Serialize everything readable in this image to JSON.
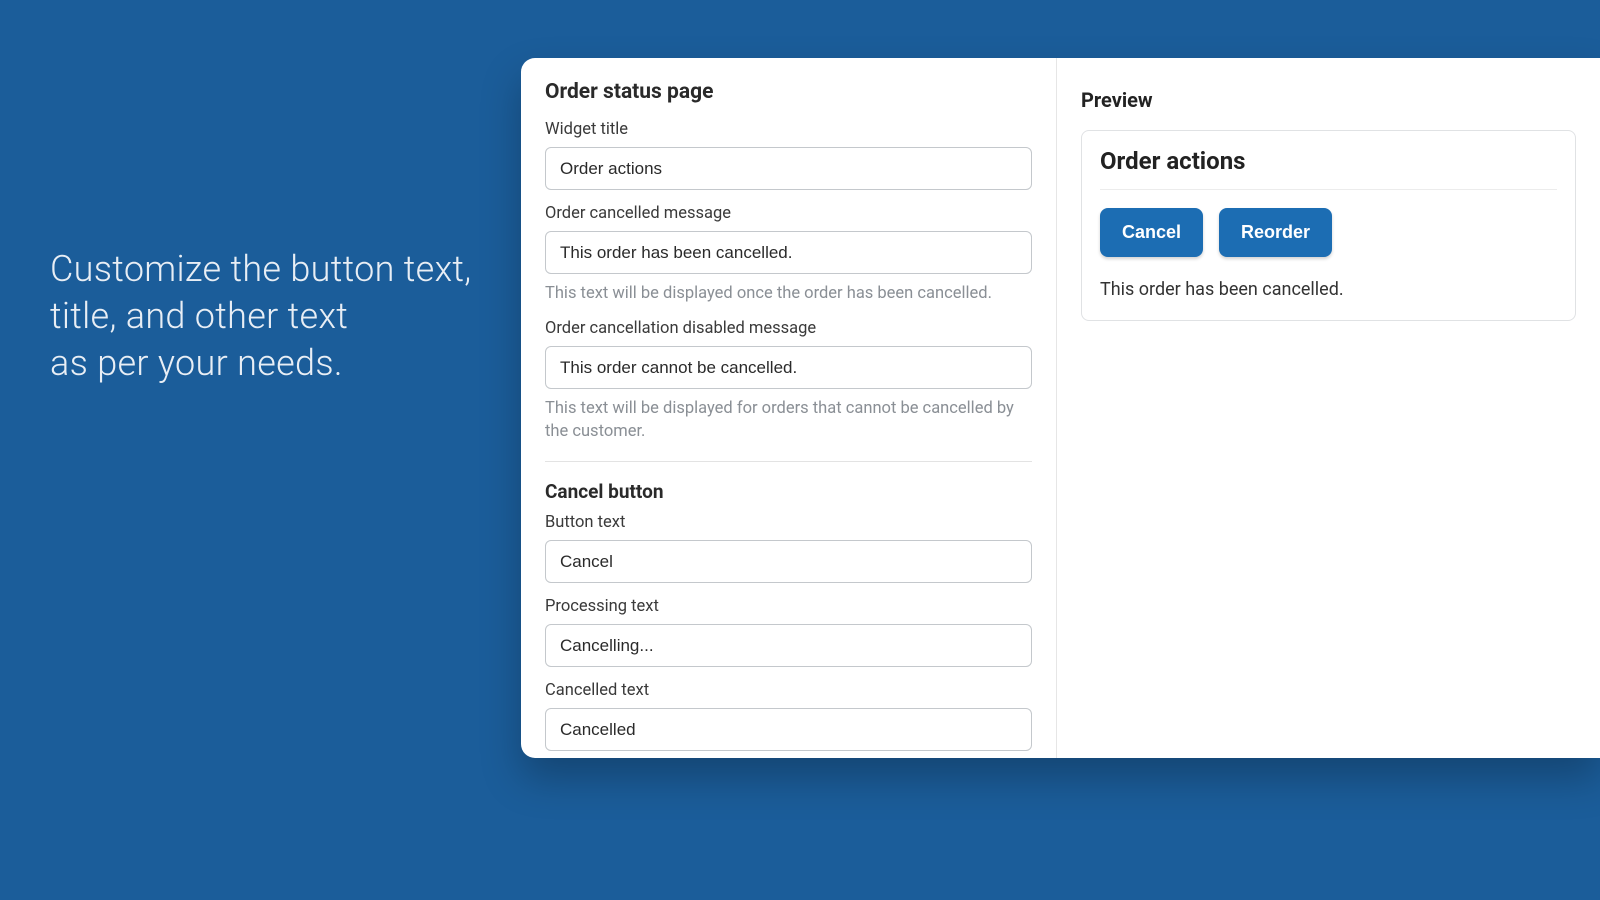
{
  "hero": {
    "line1": "Customize the button text,",
    "line2": "title, and other text",
    "line3": "as per your needs."
  },
  "form": {
    "section_order_status_page": "Order status page",
    "widget_title": {
      "label": "Widget title",
      "value": "Order actions"
    },
    "order_cancelled_message": {
      "label": "Order cancelled message",
      "value": "This order has been cancelled.",
      "help": "This text will be displayed once the order has been cancelled."
    },
    "order_cancellation_disabled_message": {
      "label": "Order cancellation disabled message",
      "value": "This order cannot be cancelled.",
      "help": "This text will be displayed for orders that cannot be cancelled by the customer."
    },
    "section_cancel_button": "Cancel button",
    "button_text": {
      "label": "Button text",
      "value": "Cancel"
    },
    "processing_text": {
      "label": "Processing text",
      "value": "Cancelling..."
    },
    "cancelled_text": {
      "label": "Cancelled text",
      "value": "Cancelled"
    }
  },
  "preview": {
    "title": "Preview",
    "card_title": "Order actions",
    "buttons": {
      "cancel": "Cancel",
      "reorder": "Reorder"
    },
    "message": "This order has been cancelled."
  }
}
